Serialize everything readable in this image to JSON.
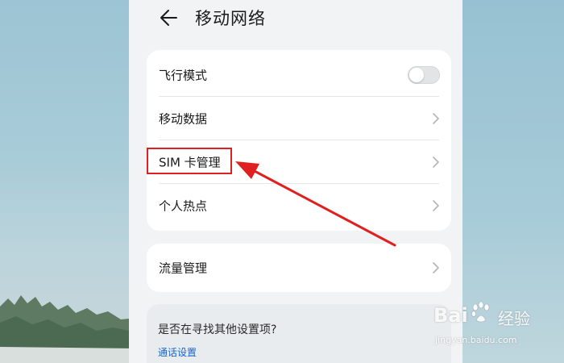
{
  "header": {
    "title": "移动网络",
    "back_icon": "back-arrow-icon"
  },
  "settings_group_1": [
    {
      "label": "飞行模式",
      "control": "toggle",
      "toggle_on": false
    },
    {
      "label": "移动数据",
      "control": "chevron-right-icon"
    },
    {
      "label": "SIM 卡管理",
      "control": "chevron-right-icon",
      "highlighted": true
    },
    {
      "label": "个人热点",
      "control": "chevron-right-icon"
    }
  ],
  "settings_group_2": [
    {
      "label": "流量管理",
      "control": "chevron-right-icon"
    }
  ],
  "suggestion": {
    "question": "是否在寻找其他设置项?",
    "link": "通话设置"
  },
  "annotation": {
    "box_color": "#e02020",
    "arrow_color": "#e02020"
  },
  "watermark": {
    "brand": "Bai",
    "brand_suffix": "经验",
    "url": "jingyan.baidu.com"
  }
}
